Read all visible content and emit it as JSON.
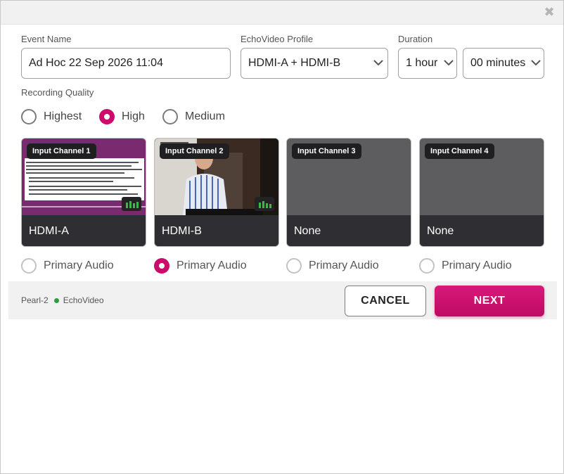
{
  "dialog": {
    "close_glyph": "✖"
  },
  "form": {
    "event_name": {
      "label": "Event Name",
      "value": "Ad Hoc 22 Sep 2026 11:04"
    },
    "profile": {
      "label": "EchoVideo Profile",
      "value": "HDMI-A + HDMI-B"
    },
    "duration": {
      "label": "Duration",
      "hours": "1 hour",
      "minutes": "00 minutes"
    }
  },
  "quality": {
    "label": "Recording Quality",
    "options": [
      {
        "label": "Highest",
        "checked": false
      },
      {
        "label": "High",
        "checked": true
      },
      {
        "label": "Medium",
        "checked": false
      }
    ]
  },
  "channels": [
    {
      "badge": "Input Channel 1",
      "source": "HDMI-A",
      "audio": "Primary Audio",
      "audio_checked": false
    },
    {
      "badge": "Input Channel 2",
      "source": "HDMI-B",
      "audio": "Primary Audio",
      "audio_checked": true
    },
    {
      "badge": "Input Channel 3",
      "source": "None",
      "audio": "Primary Audio",
      "audio_checked": false
    },
    {
      "badge": "Input Channel 4",
      "source": "None",
      "audio": "Primary Audio",
      "audio_checked": false
    }
  ],
  "footer": {
    "device": "Pearl-2",
    "service": "EchoVideo",
    "status_color": "#2a9d3f",
    "cancel_label": "CANCEL",
    "next_label": "NEXT"
  },
  "colors": {
    "accent": "#cc0a6a"
  }
}
